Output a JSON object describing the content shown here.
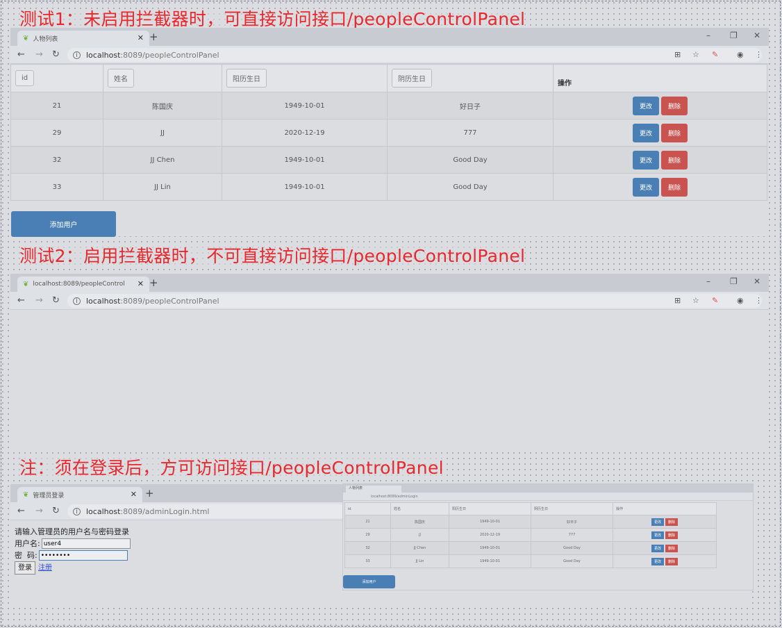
{
  "headings": {
    "test1": "测试1：未启用拦截器时，可直接访问接口/peopleControlPanel",
    "test2": "测试2：启用拦截器时，不可直接访问接口/peopleControlPanel",
    "note": "注：须在登录后，方可访问接口/peopleControlPanel"
  },
  "browser1": {
    "tab_title": "人物列表",
    "url_host": "localhost",
    "url_path": ":8089/peopleControlPanel",
    "table": {
      "headers": [
        "id",
        "姓名",
        "阳历生日",
        "阴历生日",
        "操作"
      ],
      "rows": [
        {
          "id": "21",
          "name": "陈国庆",
          "solar": "1949-10-01",
          "lunar": "好日子"
        },
        {
          "id": "29",
          "name": "JJ",
          "solar": "2020-12-19",
          "lunar": "777"
        },
        {
          "id": "32",
          "name": "JJ Chen",
          "solar": "1949-10-01",
          "lunar": "Good Day"
        },
        {
          "id": "33",
          "name": "JJ Lin",
          "solar": "1949-10-01",
          "lunar": "Good Day"
        }
      ],
      "edit_label": "更改",
      "delete_label": "删除"
    },
    "add_button": "添加用户"
  },
  "browser2": {
    "tab_title": "localhost:8089/peopleControl",
    "url_host": "localhost",
    "url_path": ":8089/peopleControlPanel"
  },
  "browser3": {
    "tab_title": "管理员登录",
    "url_host": "localhost",
    "url_path": ":8089/adminLogin.html",
    "login": {
      "prompt": "请输入管理员的用户名与密码登录",
      "username_label": "用户名:",
      "username_value": "user4",
      "password_label": "密  码:",
      "password_value": "••••••••",
      "submit_label": "登录",
      "register_link": "注册"
    }
  },
  "mini_browser": {
    "tab_title": "人物列表",
    "url": "localhost:8089/adminLogin",
    "headers": [
      "id",
      "姓名",
      "阳历生日",
      "阴历生日",
      "操作"
    ],
    "rows": [
      {
        "id": "21",
        "name": "陈国庆",
        "solar": "1949-10-01",
        "lunar": "好日子"
      },
      {
        "id": "29",
        "name": "JJ",
        "solar": "2020-12-19",
        "lunar": "777"
      },
      {
        "id": "32",
        "name": "JJ Chen",
        "solar": "1949-10-01",
        "lunar": "Good Day"
      },
      {
        "id": "33",
        "name": "JJ Lin",
        "solar": "1949-10-01",
        "lunar": "Good Day"
      }
    ],
    "edit_label": "更改",
    "delete_label": "删除",
    "add_button": "添加用户"
  },
  "colors": {
    "heading": "#e8282c",
    "primary_button": "#4a7fb5",
    "danger_button": "#c9534f"
  }
}
